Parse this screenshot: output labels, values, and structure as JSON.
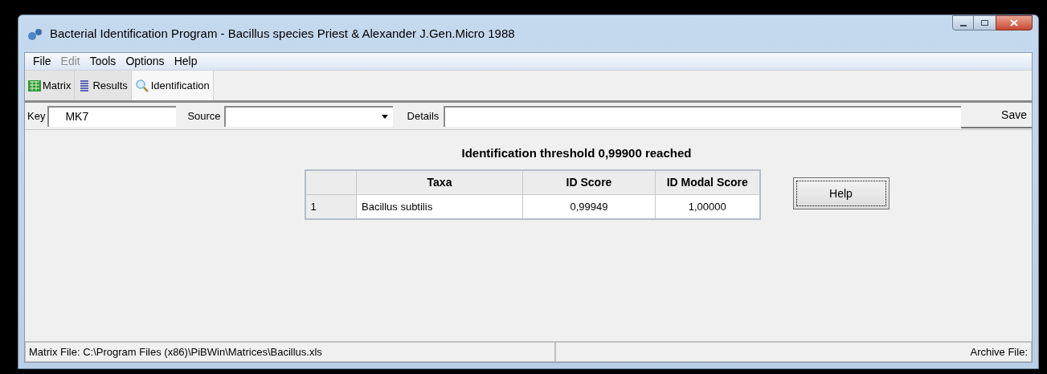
{
  "window": {
    "title": "Bacterial Identification Program - Bacillus species Priest & Alexander J.Gen.Micro 1988"
  },
  "menu": [
    {
      "label": "File",
      "disabled": false
    },
    {
      "label": "Edit",
      "disabled": true
    },
    {
      "label": "Tools",
      "disabled": false
    },
    {
      "label": "Options",
      "disabled": false
    },
    {
      "label": "Help",
      "disabled": false
    }
  ],
  "toolbar": [
    {
      "label": "Matrix",
      "kind": "matrix",
      "selected": false
    },
    {
      "label": "Results",
      "kind": "results",
      "selected": false
    },
    {
      "label": "Identification",
      "kind": "identification",
      "selected": true
    }
  ],
  "fields": {
    "key_label": "Key",
    "key_value": "MK7",
    "source_label": "Source",
    "details_label": "Details",
    "save": "Save"
  },
  "result": {
    "message": "Identification threshold 0,99900 reached",
    "columns": [
      "Taxa",
      "ID Score",
      "ID Modal Score"
    ],
    "rows": [
      {
        "index": "1",
        "cells": [
          "Bacillus subtilis",
          "0,99949",
          "1,00000"
        ]
      }
    ],
    "help": "Help"
  },
  "status_bar": {
    "matrix_file": "Matrix File: C:\\Program Files (x86)\\PiBWin\\Matrices\\Bacillus.xls",
    "archive_file": "Archive File:"
  }
}
